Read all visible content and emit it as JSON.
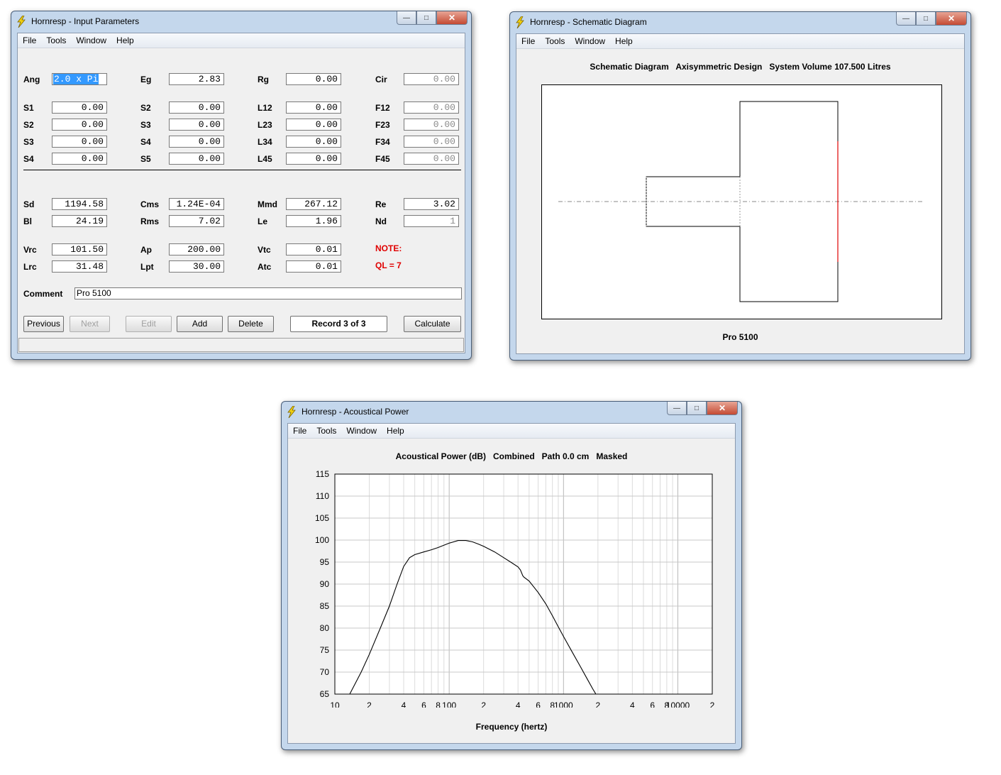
{
  "input_window": {
    "title": "Hornresp - Input Parameters",
    "menu": [
      "File",
      "Tools",
      "Window",
      "Help"
    ],
    "rows": [
      [
        {
          "label": "Ang",
          "value": "2.0 x Pi",
          "selected": true
        },
        {
          "label": "Eg",
          "value": "2.83"
        },
        {
          "label": "Rg",
          "value": "0.00"
        },
        {
          "label": "Cir",
          "value": "0.00",
          "gray": true
        }
      ],
      [
        {
          "label": "S1",
          "value": "0.00"
        },
        {
          "label": "S2",
          "value": "0.00"
        },
        {
          "label": "L12",
          "value": "0.00"
        },
        {
          "label": "F12",
          "value": "0.00",
          "gray": true
        }
      ],
      [
        {
          "label": "S2",
          "value": "0.00"
        },
        {
          "label": "S3",
          "value": "0.00"
        },
        {
          "label": "L23",
          "value": "0.00"
        },
        {
          "label": "F23",
          "value": "0.00",
          "gray": true
        }
      ],
      [
        {
          "label": "S3",
          "value": "0.00"
        },
        {
          "label": "S4",
          "value": "0.00"
        },
        {
          "label": "L34",
          "value": "0.00"
        },
        {
          "label": "F34",
          "value": "0.00",
          "gray": true
        }
      ],
      [
        {
          "label": "S4",
          "value": "0.00"
        },
        {
          "label": "S5",
          "value": "0.00"
        },
        {
          "label": "L45",
          "value": "0.00"
        },
        {
          "label": "F45",
          "value": "0.00",
          "gray": true
        }
      ],
      [
        {
          "label": "Sd",
          "value": "1194.58"
        },
        {
          "label": "Cms",
          "value": "1.24E-04"
        },
        {
          "label": "Mmd",
          "value": "267.12"
        },
        {
          "label": "Re",
          "value": "3.02"
        }
      ],
      [
        {
          "label": "Bl",
          "value": "24.19"
        },
        {
          "label": "Rms",
          "value": "7.02"
        },
        {
          "label": "Le",
          "value": "1.96"
        },
        {
          "label": "Nd",
          "value": "1",
          "gray": true
        }
      ],
      [
        {
          "label": "Vrc",
          "value": "101.50"
        },
        {
          "label": "Ap",
          "value": "200.00"
        },
        {
          "label": "Vtc",
          "value": "0.01"
        }
      ],
      [
        {
          "label": "Lrc",
          "value": "31.48"
        },
        {
          "label": "Lpt",
          "value": "30.00"
        },
        {
          "label": "Atc",
          "value": "0.01"
        }
      ]
    ],
    "note_label": "NOTE:",
    "note_value": "QL = 7",
    "comment_label": "Comment",
    "comment_value": "Pro 5100",
    "buttons": {
      "previous": "Previous",
      "next": "Next",
      "edit": "Edit",
      "add": "Add",
      "delete": "Delete",
      "record": "Record 3 of 3",
      "calculate": "Calculate"
    }
  },
  "schematic_window": {
    "title": "Hornresp - Schematic Diagram",
    "menu": [
      "File",
      "Tools",
      "Window",
      "Help"
    ],
    "heading": "Schematic Diagram   Axisymmetric Design   System Volume 107.500 Litres",
    "caption": "Pro 5100"
  },
  "power_window": {
    "title": "Hornresp - Acoustical Power",
    "menu": [
      "File",
      "Tools",
      "Window",
      "Help"
    ]
  },
  "chart_data": {
    "type": "line",
    "title": "Acoustical Power (dB)   Combined   Path 0.0 cm   Masked",
    "xlabel": "Frequency (hertz)",
    "ylabel": "",
    "x_scale": "log",
    "xlim": [
      10,
      20000
    ],
    "ylim": [
      65,
      115
    ],
    "y_ticks": [
      65,
      70,
      75,
      80,
      85,
      90,
      95,
      100,
      105,
      110,
      115
    ],
    "x_tick_labels": [
      {
        "f": 10,
        "t": "10"
      },
      {
        "f": 20,
        "t": "2"
      },
      {
        "f": 40,
        "t": "4"
      },
      {
        "f": 60,
        "t": "6"
      },
      {
        "f": 80,
        "t": "8"
      },
      {
        "f": 100,
        "t": "100"
      },
      {
        "f": 200,
        "t": "2"
      },
      {
        "f": 400,
        "t": "4"
      },
      {
        "f": 600,
        "t": "6"
      },
      {
        "f": 800,
        "t": "8"
      },
      {
        "f": 1000,
        "t": "1000"
      },
      {
        "f": 2000,
        "t": "2"
      },
      {
        "f": 4000,
        "t": "4"
      },
      {
        "f": 6000,
        "t": "6"
      },
      {
        "f": 8000,
        "t": "8"
      },
      {
        "f": 10000,
        "t": "10000"
      },
      {
        "f": 20000,
        "t": "2"
      }
    ],
    "grid": true,
    "series": [
      {
        "x": [
          13.5,
          17,
          20,
          25,
          30,
          35,
          40,
          45,
          50,
          60,
          70,
          80,
          100,
          120,
          140,
          160,
          180,
          200,
          250,
          300,
          350,
          400,
          420,
          440,
          450,
          500,
          600,
          700,
          800,
          900,
          1000,
          1200,
          1400,
          1600,
          1800,
          2000,
          2200,
          2300
        ],
        "y": [
          65,
          70,
          74,
          80,
          85,
          90,
          94,
          96,
          96.7,
          97.3,
          97.8,
          98.3,
          99.3,
          99.9,
          99.9,
          99.6,
          99.1,
          98.6,
          97.3,
          96,
          94.9,
          93.9,
          93.2,
          91.9,
          91.6,
          90.7,
          88.1,
          85.5,
          82.8,
          80.3,
          78.1,
          74.4,
          71.3,
          68.6,
          66.2,
          64.2,
          62.5,
          62
        ]
      }
    ]
  }
}
